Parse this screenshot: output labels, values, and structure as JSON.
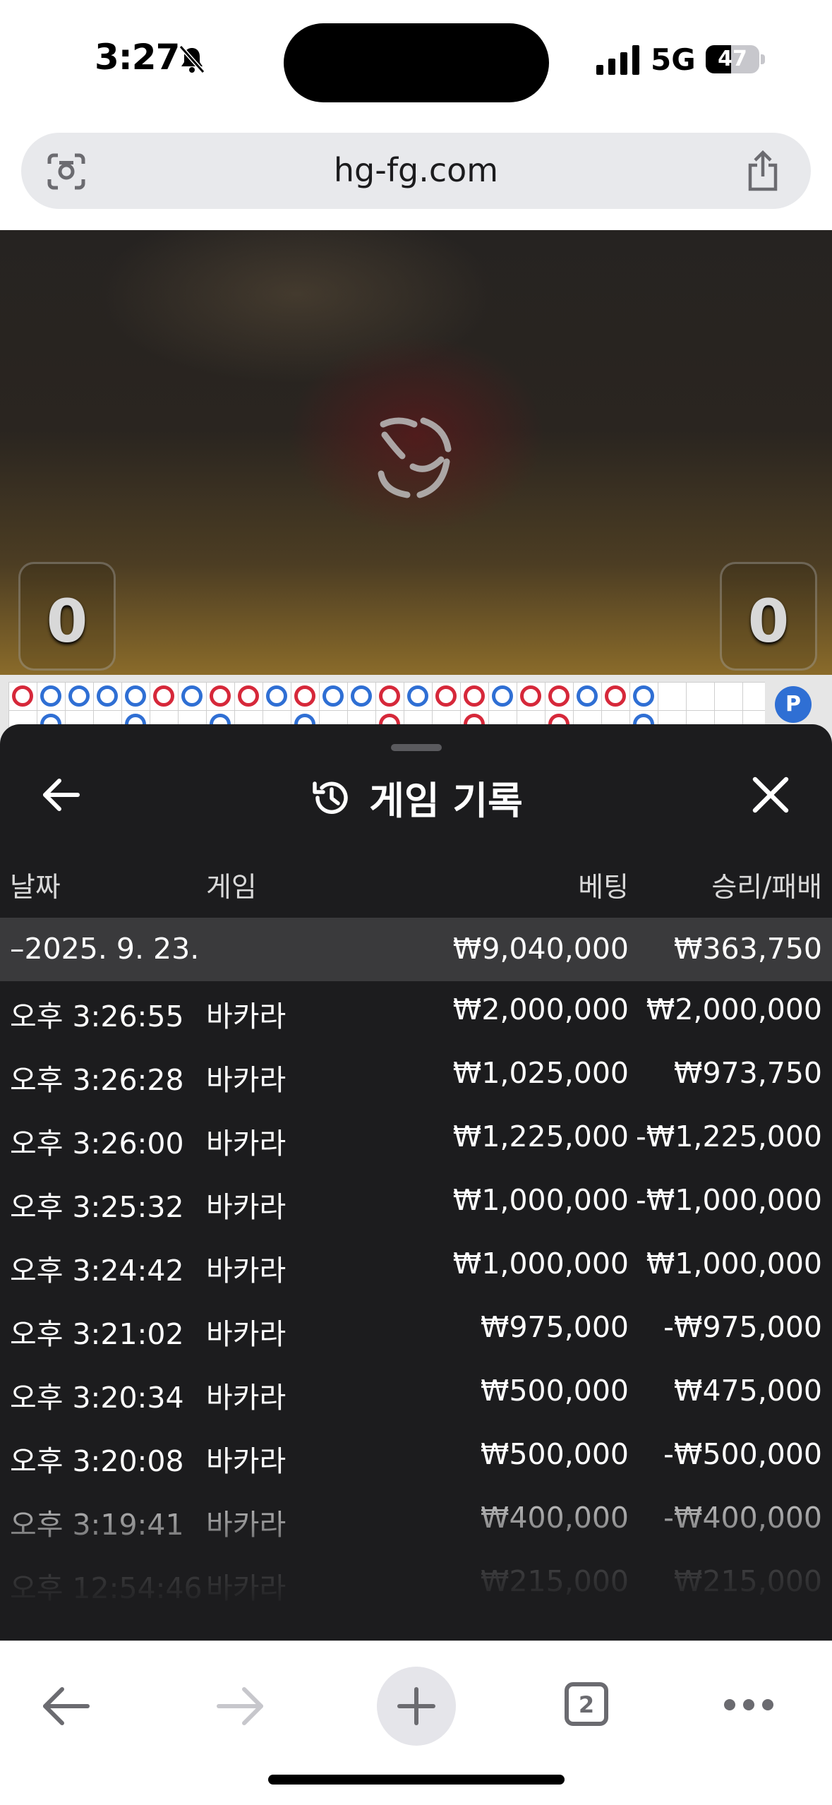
{
  "status_bar": {
    "time": "3:27",
    "network": "5G",
    "battery_level": "47",
    "battery_fraction": 0.47,
    "icons": [
      "bell-slash-icon",
      "signal-bars-icon",
      "battery-icon"
    ]
  },
  "browser": {
    "url": "hg-fg.com",
    "icons": [
      "camera-search-icon",
      "share-icon"
    ]
  },
  "game": {
    "left_score": "0",
    "right_score": "0",
    "road_indicator": "P"
  },
  "history_panel": {
    "title": "게임 기록",
    "columns": {
      "date": "날짜",
      "game": "게임",
      "bet": "베팅",
      "result": "승리/패배"
    },
    "group": {
      "date": "–2025. 9. 23.",
      "bet": "₩9,040,000",
      "result": "₩363,750"
    },
    "rows": [
      {
        "time": "오후 3:26:55",
        "game": "바카라",
        "bet": "₩2,000,000",
        "result": "₩2,000,000"
      },
      {
        "time": "오후 3:26:28",
        "game": "바카라",
        "bet": "₩1,025,000",
        "result": "₩973,750"
      },
      {
        "time": "오후 3:26:00",
        "game": "바카라",
        "bet": "₩1,225,000",
        "result": "-₩1,225,000"
      },
      {
        "time": "오후 3:25:32",
        "game": "바카라",
        "bet": "₩1,000,000",
        "result": "-₩1,000,000"
      },
      {
        "time": "오후 3:24:42",
        "game": "바카라",
        "bet": "₩1,000,000",
        "result": "₩1,000,000"
      },
      {
        "time": "오후 3:21:02",
        "game": "바카라",
        "bet": "₩975,000",
        "result": "-₩975,000"
      },
      {
        "time": "오후 3:20:34",
        "game": "바카라",
        "bet": "₩500,000",
        "result": "₩475,000"
      },
      {
        "time": "오후 3:20:08",
        "game": "바카라",
        "bet": "₩500,000",
        "result": "-₩500,000"
      },
      {
        "time": "오후 3:19:41",
        "game": "바카라",
        "bet": "₩400,000",
        "result": "-₩400,000"
      },
      {
        "time": "오후 12:54:46",
        "game": "바카라",
        "bet": "₩215,000",
        "result": "₩215,000"
      }
    ]
  },
  "toolbar": {
    "tab_count": "2",
    "icons": [
      "back-arrow-icon",
      "forward-arrow-icon",
      "new-tab-plus-icon",
      "tabs-icon",
      "more-icon"
    ]
  },
  "colors": {
    "sheet_bg": "#1c1c1e",
    "group_bg": "#3a3a3c",
    "player_blue": "#2f6fd4",
    "banker_red": "#d6283a"
  }
}
